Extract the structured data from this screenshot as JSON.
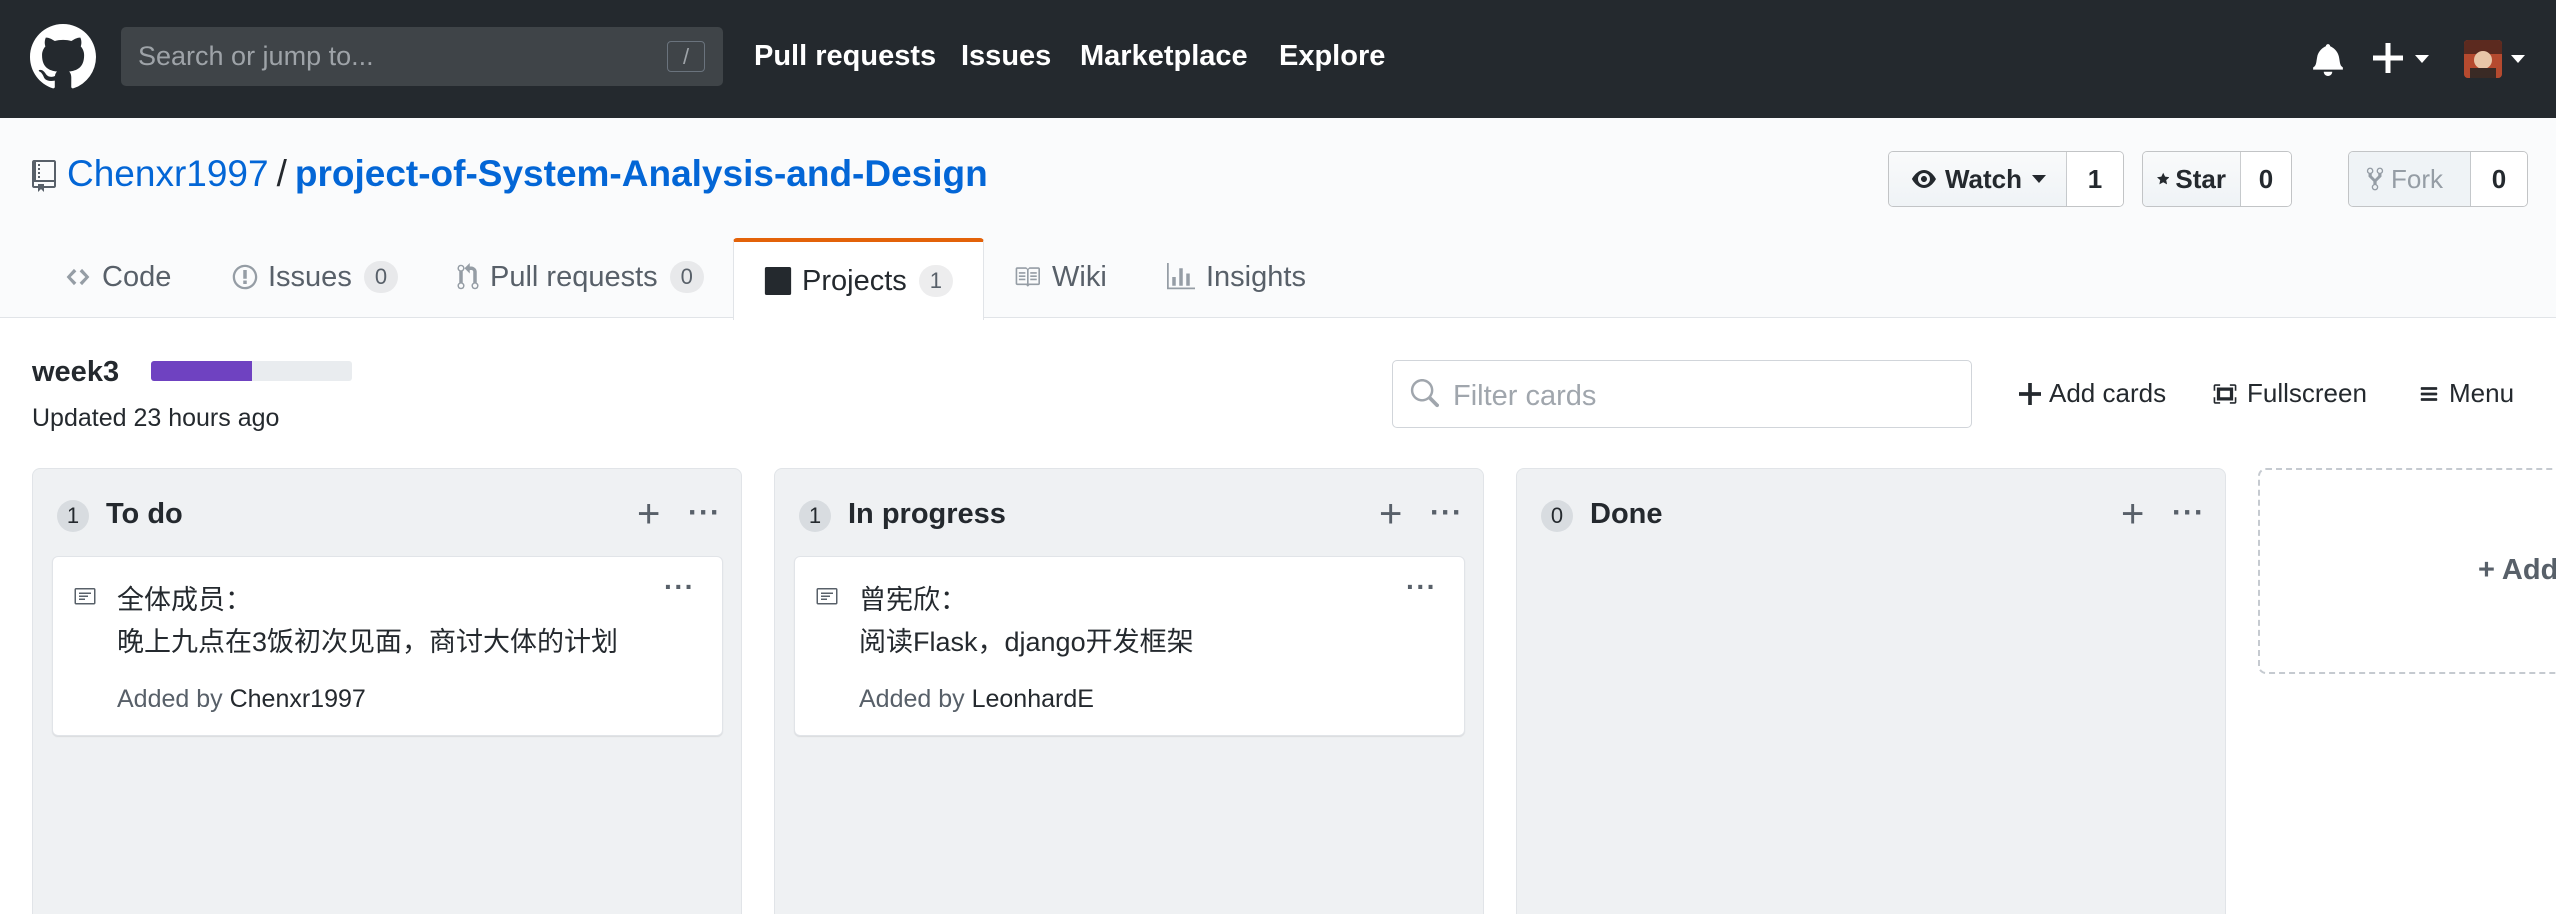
{
  "header": {
    "search_placeholder": "Search or jump to...",
    "search_shortcut": "/",
    "nav": [
      "Pull requests",
      "Issues",
      "Marketplace",
      "Explore"
    ]
  },
  "repo": {
    "owner": "Chenxr1997",
    "separator": "/",
    "name": "project-of-System-Analysis-and-Design",
    "watch_label": "Watch",
    "watch_count": "1",
    "star_label": "Star",
    "star_count": "0",
    "fork_label": "Fork",
    "fork_count": "0"
  },
  "tabs": [
    {
      "label": "Code",
      "count": null
    },
    {
      "label": "Issues",
      "count": "0"
    },
    {
      "label": "Pull requests",
      "count": "0"
    },
    {
      "label": "Projects",
      "count": "1",
      "selected": true
    },
    {
      "label": "Wiki",
      "count": null
    },
    {
      "label": "Insights",
      "count": null
    }
  ],
  "project": {
    "name": "week3",
    "progress_fraction": 0.5,
    "updated": "Updated 23 hours ago",
    "filter_placeholder": "Filter cards",
    "add_cards_label": "Add cards",
    "fullscreen_label": "Fullscreen",
    "menu_label": "Menu",
    "add_column_label": "+ Add"
  },
  "columns": [
    {
      "title": "To do",
      "count": "1",
      "card": {
        "line1": "全体成员：",
        "line2": "晚上九点在3饭初次见面，商讨大体的计划",
        "added_by_label": "Added by",
        "added_by": "Chenxr1997"
      }
    },
    {
      "title": "In progress",
      "count": "1",
      "card": {
        "line1": "曾宪欣：",
        "line2": "阅读Flask，django开发框架",
        "added_by_label": "Added by",
        "added_by": "LeonhardE"
      }
    },
    {
      "title": "Done",
      "count": "0",
      "card": null
    }
  ],
  "colors": {
    "topbar": "#24292e",
    "link": "#0366d6",
    "progress": "#6f42c1",
    "tab_accent": "#e36209"
  }
}
